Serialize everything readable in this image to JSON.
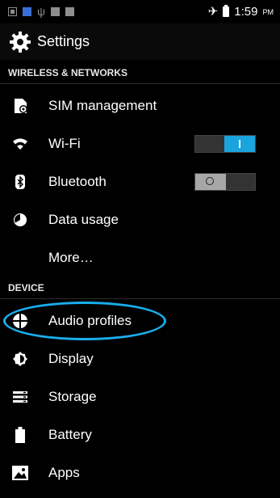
{
  "status_bar": {
    "time": "1:59",
    "ampm": "PM",
    "icons": [
      "notification-icon",
      "phone-icon",
      "usb-icon",
      "image-icon",
      "square-icon",
      "airplane-icon",
      "battery-icon"
    ]
  },
  "action_bar": {
    "title": "Settings",
    "icon": "gear-icon"
  },
  "sections": [
    {
      "header": "WIRELESS & NETWORKS",
      "items": [
        {
          "label": "SIM management",
          "icon": "sim-card-icon"
        },
        {
          "label": "Wi-Fi",
          "icon": "wifi-icon",
          "toggle": "on"
        },
        {
          "label": "Bluetooth",
          "icon": "bluetooth-icon",
          "toggle": "off"
        },
        {
          "label": "Data usage",
          "icon": "data-usage-icon"
        },
        {
          "label": "More…",
          "icon": ""
        }
      ]
    },
    {
      "header": "DEVICE",
      "items": [
        {
          "label": "Audio profiles",
          "icon": "audio-profiles-icon",
          "highlighted": true
        },
        {
          "label": "Display",
          "icon": "display-icon"
        },
        {
          "label": "Storage",
          "icon": "storage-icon"
        },
        {
          "label": "Battery",
          "icon": "battery-icon"
        },
        {
          "label": "Apps",
          "icon": "apps-icon"
        }
      ]
    }
  ],
  "colors": {
    "background": "#000000",
    "accent": "#1aa4de",
    "highlight": "#19aeee"
  }
}
